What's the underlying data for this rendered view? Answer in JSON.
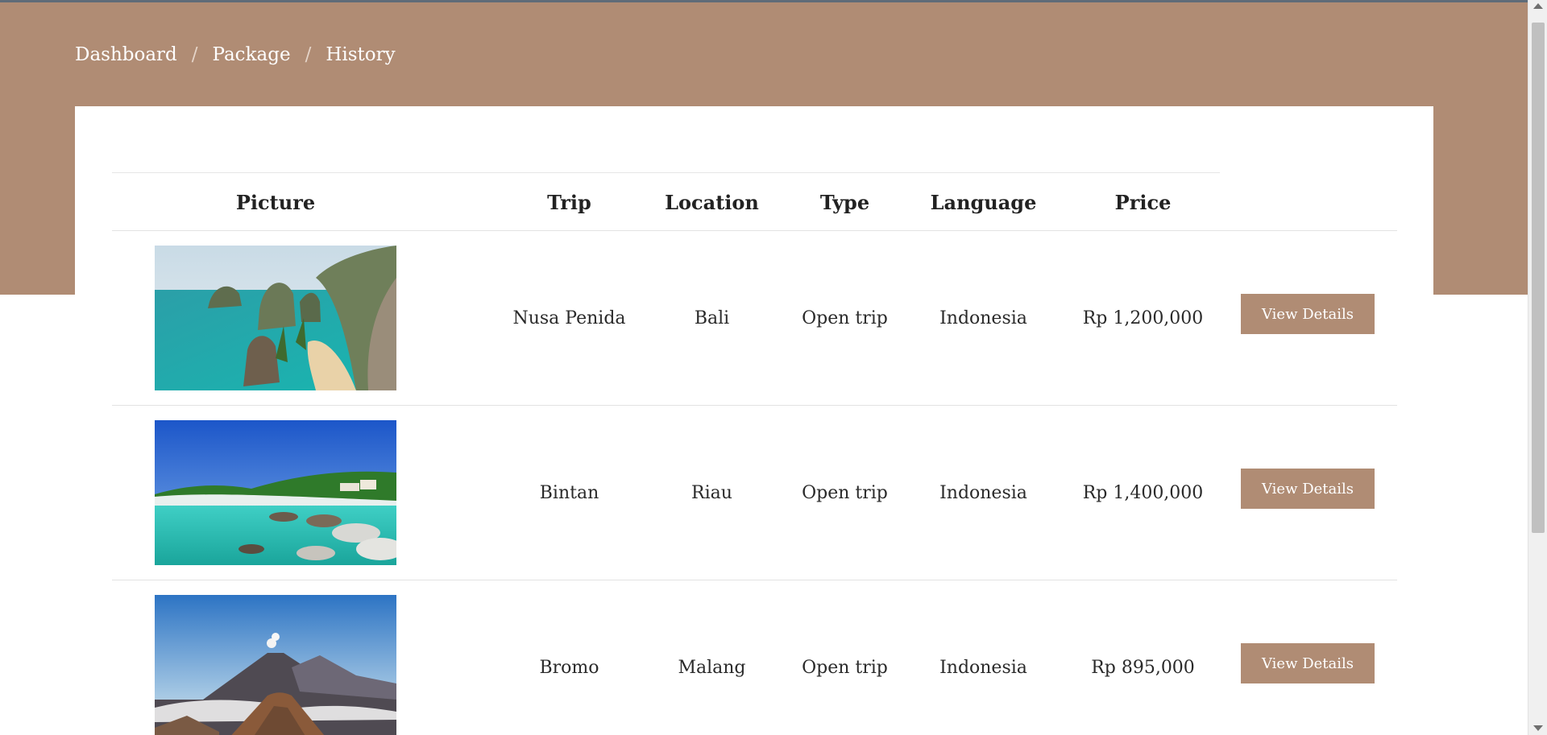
{
  "breadcrumb": {
    "items": [
      "Dashboard",
      "Package",
      "History"
    ],
    "separator": "/"
  },
  "table": {
    "headers": {
      "picture": "Picture",
      "trip": "Trip",
      "location": "Location",
      "type": "Type",
      "language": "Language",
      "price": "Price"
    },
    "rows": [
      {
        "trip": "Nusa Penida",
        "location": "Bali",
        "type": "Open trip",
        "language": "Indonesia",
        "price": "Rp 1,200,000",
        "action": "View Details",
        "image": "coastal-cliffs-beach-photo"
      },
      {
        "trip": "Bintan",
        "location": "Riau",
        "type": "Open trip",
        "language": "Indonesia",
        "price": "Rp 1,400,000",
        "action": "View Details",
        "image": "tropical-lagoon-rocks-photo"
      },
      {
        "trip": "Bromo",
        "location": "Malang",
        "type": "Open trip",
        "language": "Indonesia",
        "price": "Rp 895,000",
        "action": "View Details",
        "image": "volcano-mountain-photo"
      }
    ]
  },
  "colors": {
    "brand": "#b08c74",
    "text": "#222222",
    "divider": "#e3e3e3"
  }
}
